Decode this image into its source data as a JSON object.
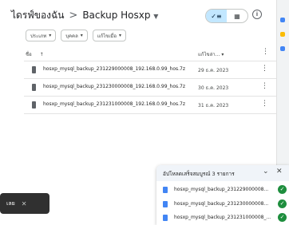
{
  "breadcrumb": {
    "root": "ไดรฟ์ของฉัน",
    "separator": ">",
    "current": "Backup Hosxp"
  },
  "view_toggle": {
    "list_icon": "✓≡",
    "grid_icon": "▦"
  },
  "filters": [
    {
      "label": "ประเภท"
    },
    {
      "label": "บุคคล"
    },
    {
      "label": "แก้ไขเมื่อ"
    }
  ],
  "columns": {
    "name": "ชื่อ",
    "sort_icon": "↑",
    "modified": "แก้ไขล่า..."
  },
  "files": [
    {
      "name": "hosxp_mysql_backup_231229000008_192.168.0.99_hos.7z",
      "date": "29 ธ.ค. 2023"
    },
    {
      "name": "hosxp_mysql_backup_231230000008_192.168.0.99_hos.7z",
      "date": "30 ธ.ค. 2023"
    },
    {
      "name": "hosxp_mysql_backup_231231000008_192.168.0.99_hos.7z",
      "date": "31 ธ.ค. 2023"
    }
  ],
  "toast": {
    "text": "เลย",
    "close": "✕"
  },
  "upload_panel": {
    "title": "อัปโหลดเสร็จสมบูรณ์ 3 รายการ",
    "items": [
      {
        "name": "hosxp_mysql_backup_231229000008..."
      },
      {
        "name": "hosxp_mysql_backup_231230000008..."
      },
      {
        "name": "hosxp_mysql_backup_231231000008_..."
      }
    ]
  },
  "colors": {
    "accent_bg": "#c2e7ff",
    "success": "#1e8e3e",
    "file_blue": "#4285f4",
    "toast_bg": "#303030"
  }
}
